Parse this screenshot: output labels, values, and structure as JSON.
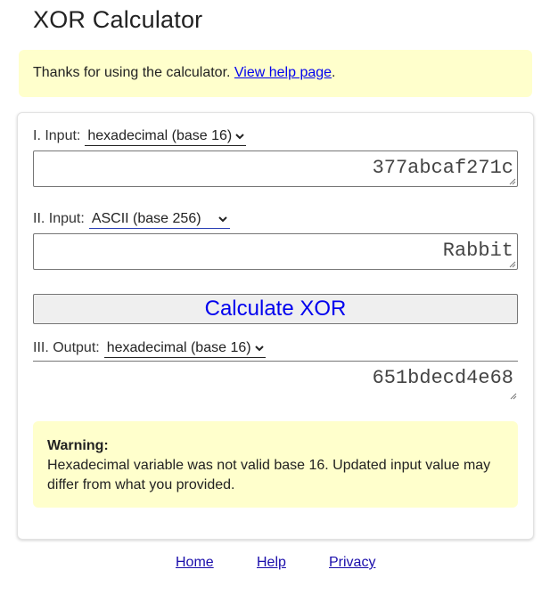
{
  "page": {
    "title": "XOR Calculator"
  },
  "notice": {
    "text": "Thanks for using the calculator. ",
    "link": "View help page",
    "suffix": "."
  },
  "input1": {
    "label": "I. Input:",
    "base": "hexadecimal (base 16)",
    "value": "377abcaf271c"
  },
  "input2": {
    "label": "II. Input:",
    "base": "ASCII (base 256)",
    "value": "Rabbit"
  },
  "calculate_label": "Calculate XOR",
  "output": {
    "label": "III. Output:",
    "base": "hexadecimal (base 16)",
    "value": "651bdecd4e68"
  },
  "warning": {
    "title": "Warning:",
    "message": "Hexadecimal variable was not valid base 16. Updated input value may differ from what you provided."
  },
  "footer": {
    "home": "Home",
    "help": "Help",
    "privacy": "Privacy"
  },
  "colors": {
    "notice_bg": "#ffffcc",
    "link": "#0000ee",
    "button_text": "#0000ee",
    "button_bg": "#efefef"
  }
}
